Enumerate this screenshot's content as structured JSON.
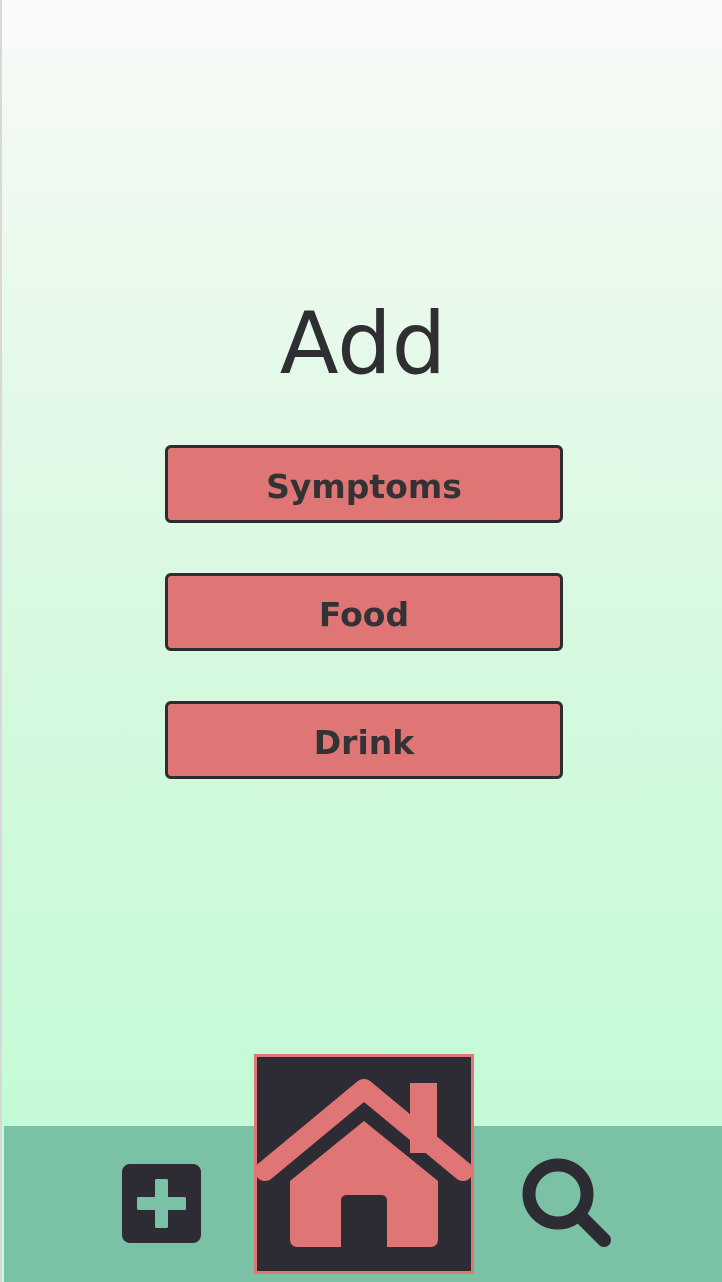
{
  "page": {
    "title": "Add"
  },
  "menu": {
    "items": [
      {
        "label": "Symptoms"
      },
      {
        "label": "Food"
      },
      {
        "label": "Drink"
      }
    ]
  },
  "tab_bar": {
    "tabs": [
      {
        "icon": "plus-icon",
        "selected": false
      },
      {
        "icon": "home-icon",
        "selected": true
      },
      {
        "icon": "search-icon",
        "selected": false
      }
    ]
  },
  "colors": {
    "button_fill": "#e07575",
    "tab_bar": "#7bc1a6",
    "dark": "#2d2c35",
    "background_top": "#fafafa",
    "background_bottom": "#c3fbd6"
  }
}
